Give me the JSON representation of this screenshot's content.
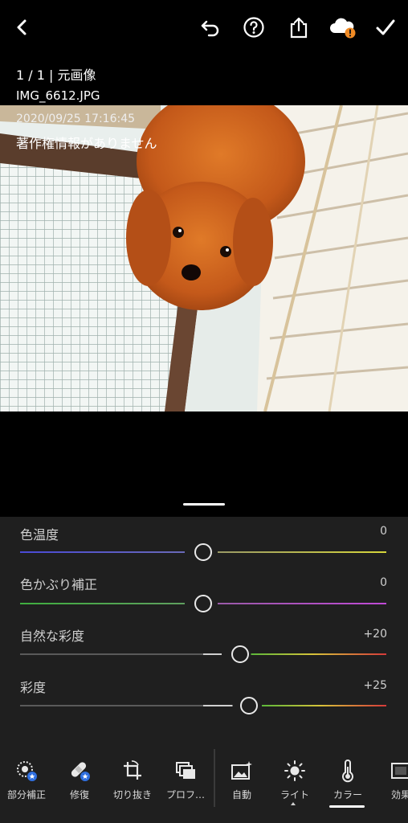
{
  "topbar": {
    "icons": [
      "back-icon",
      "undo-icon",
      "help-icon",
      "share-icon",
      "cloud-warning-icon",
      "done-check-icon"
    ]
  },
  "photo_info": {
    "counter": "1 / 1 | 元画像",
    "filename": "IMG_6612.JPG",
    "timestamp": "2020/09/25 17:16:45",
    "copyright": "著作権情報がありません"
  },
  "color_panel": {
    "sliders": [
      {
        "label": "色温度",
        "value": "0",
        "level": 0.5
      },
      {
        "label": "色かぶり補正",
        "value": "0",
        "level": 0.5
      },
      {
        "label": "自然な彩度",
        "value": "+20",
        "level": 0.6
      },
      {
        "label": "彩度",
        "value": "+25",
        "level": 0.625
      }
    ]
  },
  "toolbar": {
    "tools": [
      {
        "label": "部分補正",
        "icon": "selective-adjust-icon"
      },
      {
        "label": "修復",
        "icon": "healing-bandage-icon"
      },
      {
        "label": "切り抜き",
        "icon": "crop-rotate-icon"
      },
      {
        "label": "プロフ…",
        "icon": "profiles-icon"
      },
      {
        "label": "自動",
        "icon": "auto-image-icon"
      },
      {
        "label": "ライト",
        "icon": "light-sun-icon"
      },
      {
        "label": "カラー",
        "icon": "color-thermometer-icon"
      },
      {
        "label": "効果",
        "icon": "effects-icon"
      }
    ],
    "active": "カラー"
  },
  "colors": {
    "accent": "#ffffff",
    "warning": "#f08a24",
    "badge": "#2f6fe0",
    "panel_bg": "#1f1f1f"
  }
}
